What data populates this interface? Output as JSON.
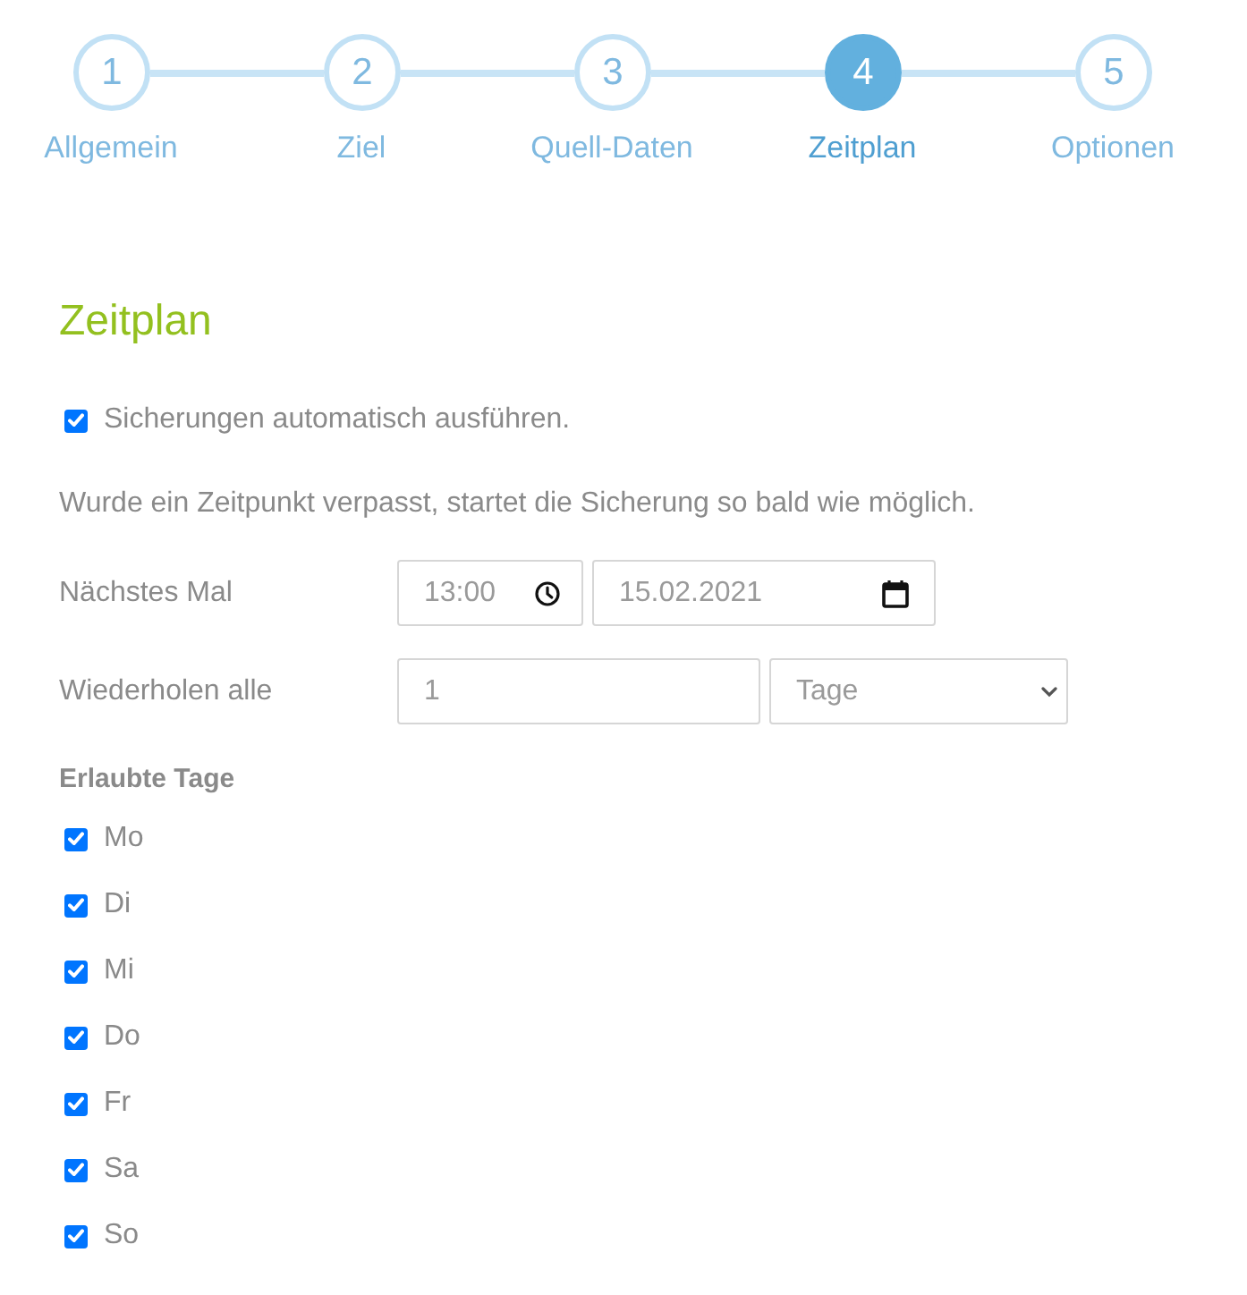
{
  "steps": [
    {
      "number": "1",
      "label": "Allgemein",
      "selected": false
    },
    {
      "number": "2",
      "label": "Ziel",
      "selected": false
    },
    {
      "number": "3",
      "label": "Quell-Daten",
      "selected": false
    },
    {
      "number": "4",
      "label": "Zeitplan",
      "selected": true
    },
    {
      "number": "5",
      "label": "Optionen",
      "selected": false
    }
  ],
  "heading": "Zeitplan",
  "auto_run": {
    "label": "Sicherungen automatisch ausführen.",
    "checked": true
  },
  "note": "Wurde ein Zeitpunkt verpasst, startet die Sicherung so bald wie möglich.",
  "next_run": {
    "label": "Nächstes Mal",
    "time": "13:00",
    "date": "15.02.2021"
  },
  "repeat": {
    "label": "Wiederholen alle",
    "value": "1",
    "unit": "Tage"
  },
  "allowed_days": {
    "title": "Erlaubte Tage",
    "days": [
      {
        "label": "Mo",
        "checked": true
      },
      {
        "label": "Di",
        "checked": true
      },
      {
        "label": "Mi",
        "checked": true
      },
      {
        "label": "Do",
        "checked": true
      },
      {
        "label": "Fr",
        "checked": true
      },
      {
        "label": "Sa",
        "checked": true
      },
      {
        "label": "So",
        "checked": true
      }
    ]
  }
}
